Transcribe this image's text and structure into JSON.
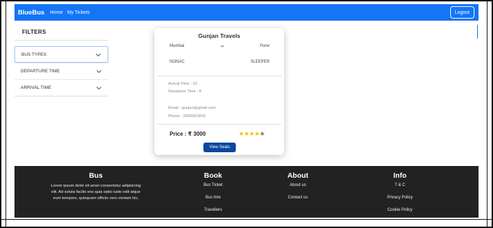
{
  "navbar": {
    "brand": "BlueBus",
    "links": [
      "Home",
      "My Tickets"
    ],
    "logout_label": "Logout",
    "color": "#1475f7"
  },
  "sidebar": {
    "title": "FILTERS",
    "filters": [
      {
        "label": "BUS TYPES",
        "icon": "chevron-down-icon"
      },
      {
        "label": "DEPARTURE TIME",
        "icon": "chevron-down-icon"
      },
      {
        "label": "ARRIVAL TIME",
        "icon": "chevron-down-icon"
      }
    ]
  },
  "card": {
    "operator": "Gunjan Travels",
    "from": "Mumbai",
    "arrow": "⇒",
    "to": "Pune",
    "ac_type": "NONAC",
    "seat_type": "SLEEPER",
    "arrival": "Arrival Time : 10",
    "departure": "Departure Time : 8",
    "email": "Email : gunjan@gmail.com",
    "phone": "Phone : 9309951829",
    "price": "Price : ₹ 3000",
    "rating": 4,
    "rating_max": 5,
    "view_label": "View Seats",
    "button_color": "#0d47a1"
  },
  "footer": {
    "bus": {
      "heading": "Bus",
      "description": "Lorem ipsum dolor sit amet consectetur adipisicing elit. Ad soluta facilis eos quia optio iusto odit atque eum tempore, quisquam officiis vero veniam hic,"
    },
    "book": {
      "heading": "Book",
      "links": [
        "Bus Ticket",
        "Bus hire",
        "Travellers"
      ]
    },
    "about": {
      "heading": "About",
      "links": [
        "About us",
        "Contact us"
      ]
    },
    "info": {
      "heading": "Info",
      "links": [
        "T & C",
        "Privacy Policy",
        "Cookie Policy"
      ]
    },
    "background": "#222222"
  }
}
